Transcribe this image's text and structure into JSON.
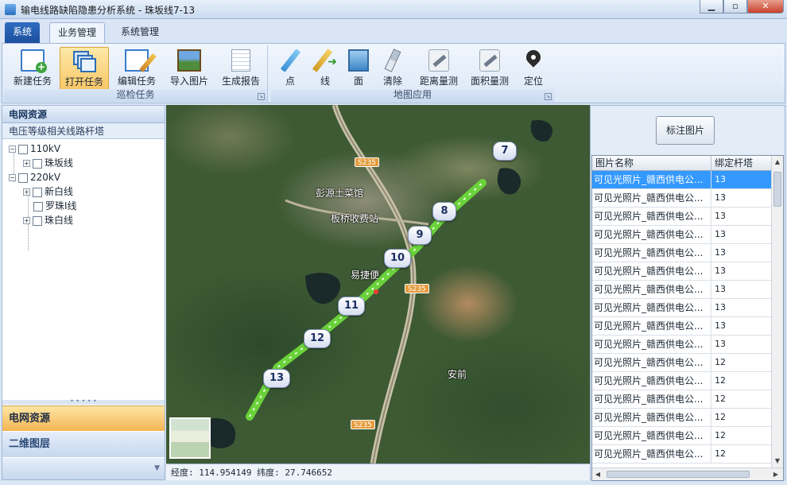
{
  "window": {
    "title": "输电线路缺陷隐患分析系统 - 珠坂线7-13",
    "minimize": "▁",
    "maximize": "▫",
    "close": "✕"
  },
  "tabs": {
    "system": "系统",
    "business": "业务管理",
    "admin": "系统管理"
  },
  "ribbon": {
    "groups": {
      "patrol": "巡检任务",
      "map": "地图应用"
    },
    "buttons": {
      "new_task": "新建任务",
      "open_task": "打开任务",
      "edit_task": "编辑任务",
      "import_image": "导入图片",
      "report": "生成报告",
      "point": "点",
      "line": "线",
      "area": "面",
      "clear": "清除",
      "measure_distance": "距离量测",
      "measure_area": "面积量测",
      "locate": "定位"
    }
  },
  "left_panel": {
    "header": "电网资源",
    "subheader": "电压等级相关线路杆塔",
    "tree": {
      "kv110": "110kV",
      "zhuban": "珠坂线",
      "kv220": "220kV",
      "xinbai": "新白线",
      "luozhu": "罗珠I线",
      "zhubai": "珠白线"
    },
    "nav": {
      "grid": "电网资源",
      "layers": "二维图层"
    }
  },
  "map": {
    "markers": [
      "7",
      "8",
      "9",
      "10",
      "11",
      "12",
      "13"
    ],
    "labels": {
      "restaurant": "彭源土菜馆",
      "toll": "板桥收费站",
      "yijie": "易捷便",
      "anqian": "安前"
    },
    "roads": [
      "S235",
      "S235",
      "S235"
    ]
  },
  "status": {
    "coordinates": "经度: 114.954149  纬度: 27.746652"
  },
  "right_panel": {
    "tag_button": "标注图片",
    "columns": {
      "name": "图片名称",
      "tower": "绑定杆塔"
    },
    "rows": [
      {
        "name": "可见光照片_赣西供电公...",
        "tower": "13"
      },
      {
        "name": "可见光照片_赣西供电公...",
        "tower": "13"
      },
      {
        "name": "可见光照片_赣西供电公...",
        "tower": "13"
      },
      {
        "name": "可见光照片_赣西供电公...",
        "tower": "13"
      },
      {
        "name": "可见光照片_赣西供电公...",
        "tower": "13"
      },
      {
        "name": "可见光照片_赣西供电公...",
        "tower": "13"
      },
      {
        "name": "可见光照片_赣西供电公...",
        "tower": "13"
      },
      {
        "name": "可见光照片_赣西供电公...",
        "tower": "13"
      },
      {
        "name": "可见光照片_赣西供电公...",
        "tower": "13"
      },
      {
        "name": "可见光照片_赣西供电公...",
        "tower": "13"
      },
      {
        "name": "可见光照片_赣西供电公...",
        "tower": "12"
      },
      {
        "name": "可见光照片_赣西供电公...",
        "tower": "12"
      },
      {
        "name": "可见光照片_赣西供电公...",
        "tower": "12"
      },
      {
        "name": "可见光照片_赣西供电公...",
        "tower": "12"
      },
      {
        "name": "可见光照片_赣西供电公...",
        "tower": "12"
      },
      {
        "name": "可见光照片_赣西供电公...",
        "tower": "12"
      }
    ]
  },
  "colors": {
    "accent": "#3399ff",
    "route": "#6ad23a",
    "selected_nav": "#f4b454"
  }
}
